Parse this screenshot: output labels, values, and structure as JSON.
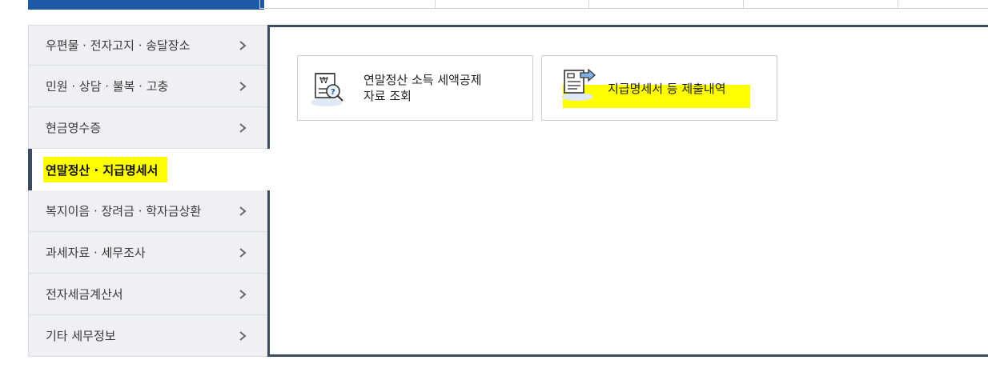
{
  "menu": {
    "items": [
      {
        "label": "우편물 · 전자고지 · 송달장소"
      },
      {
        "label": "민원 · 상담 · 불복 · 고충"
      },
      {
        "label": "현금영수증"
      },
      {
        "label": "연말정산 · 지급명세서",
        "active": true
      },
      {
        "label": "복지이음 · 장려금 · 학자금상환"
      },
      {
        "label": "과세자료 · 세무조사"
      },
      {
        "label": "전자세금계산서"
      },
      {
        "label": "기타 세무정보"
      }
    ]
  },
  "cards": [
    {
      "line1": "연말정산 소득 세액공제",
      "line2": "자료 조회",
      "icon": "receipt-search-icon"
    },
    {
      "line1": "지급명세서 등 제출내역",
      "icon": "document-submit-icon"
    }
  ],
  "colors": {
    "accent_navy": "#3c4b60",
    "top_blue": "#1d5aa6",
    "highlight": "#ffff00",
    "menu_bg": "#eef0f3"
  }
}
